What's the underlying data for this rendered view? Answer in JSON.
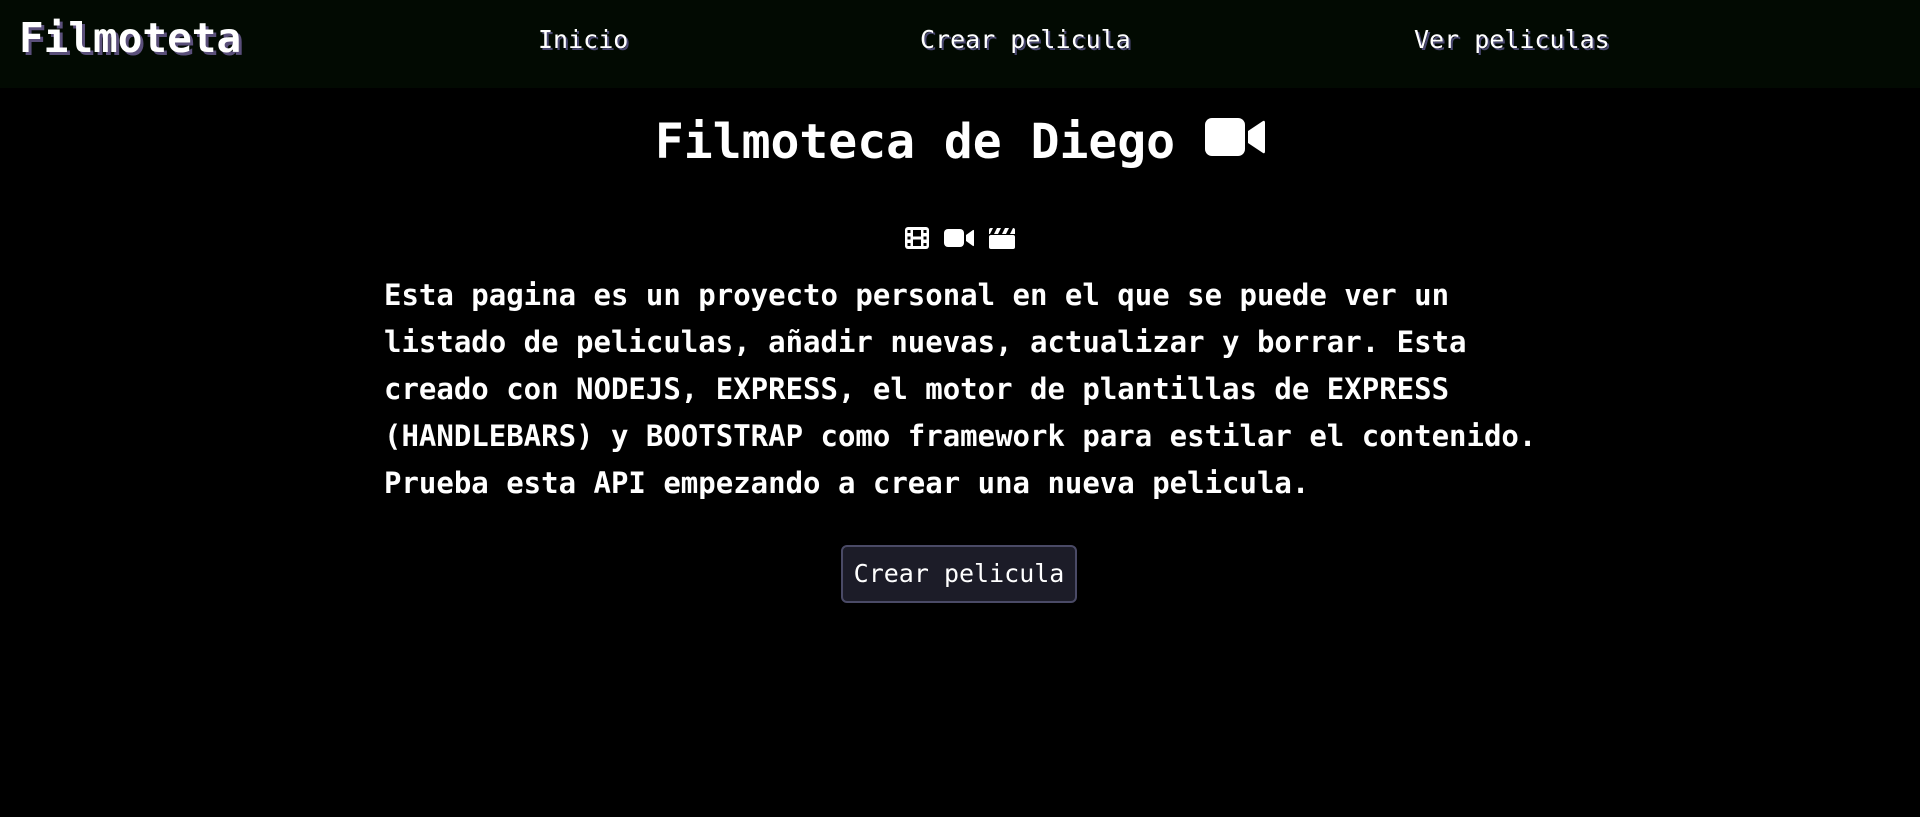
{
  "navbar": {
    "brand": "Filmoteta",
    "links": [
      {
        "label": "Inicio"
      },
      {
        "label": "Crear pelicula"
      },
      {
        "label": "Ver peliculas"
      }
    ]
  },
  "main": {
    "title": "Filmoteca de Diego",
    "title_icon": "video-camera-icon",
    "icons": [
      "film-icon",
      "video-camera-icon",
      "clapperboard-icon"
    ],
    "description": "Esta pagina es un proyecto personal en el que se puede ver un listado de peliculas, añadir nuevas, actualizar y borrar. Esta creado con NODEJS, EXPRESS, el motor de plantillas de EXPRESS (HANDLEBARS) y BOOTSTRAP como framework para estilar el contenido. Prueba esta API empezando a crear una nueva pelicula.",
    "cta_label": "Crear pelicula"
  },
  "colors": {
    "background": "#000000",
    "navbar_bg": "#020a02",
    "text": "#ffffff",
    "button_bg": "#1c1c28",
    "button_border": "#4a4a66"
  }
}
